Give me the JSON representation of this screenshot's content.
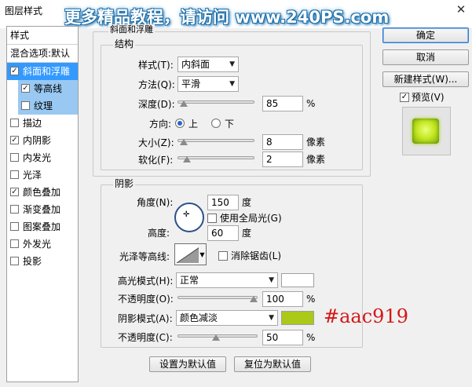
{
  "window": {
    "title": "图层样式",
    "watermark": "更多精品教程，请访问 www.240PS.com",
    "close_glyph": "✕"
  },
  "left_panel": {
    "styles_label": "样式",
    "blend_label": "混合选项:默认",
    "items": [
      {
        "label": "斜面和浮雕",
        "checked": "✓"
      },
      {
        "label": "等高线",
        "checked": "✓"
      },
      {
        "label": "纹理",
        "checked": ""
      },
      {
        "label": "描边",
        "checked": ""
      },
      {
        "label": "内阴影",
        "checked": "✓"
      },
      {
        "label": "内发光",
        "checked": ""
      },
      {
        "label": "光泽",
        "checked": ""
      },
      {
        "label": "颜色叠加",
        "checked": "✓"
      },
      {
        "label": "渐变叠加",
        "checked": ""
      },
      {
        "label": "图案叠加",
        "checked": ""
      },
      {
        "label": "外发光",
        "checked": ""
      },
      {
        "label": "投影",
        "checked": ""
      }
    ]
  },
  "bevel": {
    "group_title": "斜面和浮雕",
    "structure_title": "结构",
    "style_label": "样式(T):",
    "style_value": "内斜面",
    "technique_label": "方法(Q):",
    "technique_value": "平滑",
    "depth_label": "深度(D):",
    "depth_value": "85",
    "depth_unit": "%",
    "direction_label": "方向:",
    "dir_up": "上",
    "dir_down": "下",
    "size_label": "大小(Z):",
    "size_value": "8",
    "size_unit": "像素",
    "soften_label": "软化(F):",
    "soften_value": "2",
    "soften_unit": "像素"
  },
  "shading": {
    "title": "阴影",
    "angle_label": "角度(N):",
    "angle_value": "150",
    "angle_unit": "度",
    "global_light_label": "使用全局光(G)",
    "altitude_label": "高度:",
    "altitude_value": "60",
    "altitude_unit": "度",
    "gloss_label": "光泽等高线:",
    "antialias_label": "消除锯齿(L)",
    "highlight_mode_label": "高光模式(H):",
    "highlight_mode_value": "正常",
    "highlight_opacity_label": "不透明度(O):",
    "highlight_opacity_value": "100",
    "shadow_mode_label": "阴影模式(A):",
    "shadow_mode_value": "颜色减淡",
    "shadow_opacity_label": "不透明度(C):",
    "shadow_opacity_value": "50",
    "percent": "%"
  },
  "buttons": {
    "make_default": "设置为默认值",
    "reset_default": "复位为默认值",
    "ok": "确定",
    "cancel": "取消",
    "new_style": "新建样式(W)...",
    "preview_label": "预览(V)"
  },
  "annotation": {
    "color_text": "#aac919"
  },
  "colors": {
    "shadow_color": "#aac919",
    "highlight_color": "#ffffff",
    "selection": "#3399ff"
  }
}
